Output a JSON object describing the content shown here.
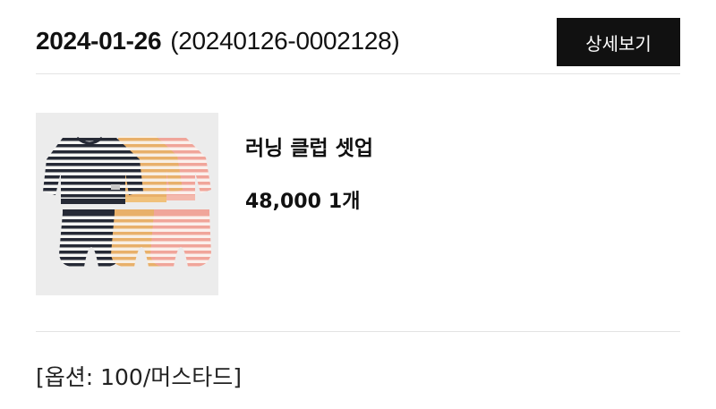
{
  "order": {
    "date": "2024-01-26",
    "number": "(20240126-0002128)",
    "detail_button_label": "상세보기"
  },
  "product": {
    "image_icon": "striped-baby-clothes-set-image",
    "name": "러닝 클럽 셋업",
    "price": "48,000",
    "quantity": "1개"
  },
  "option": {
    "text": "[옵션: 100/머스타드]"
  }
}
